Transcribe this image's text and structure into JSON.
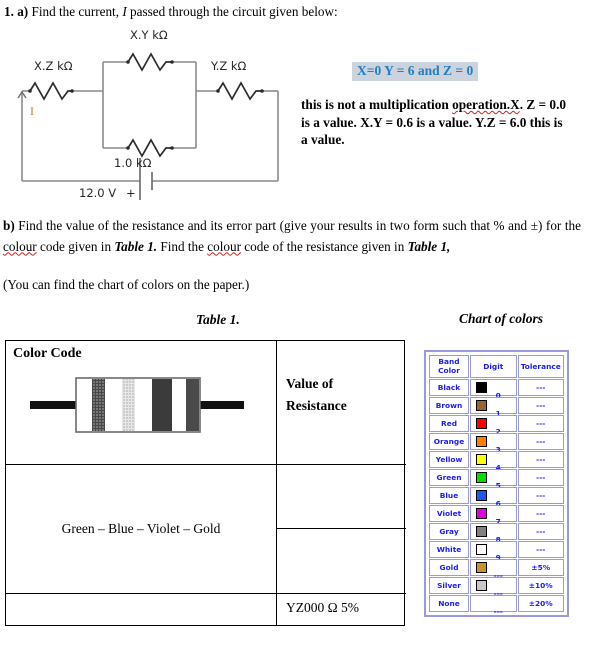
{
  "part_a": {
    "heading_number": "1. a)",
    "heading_text": " Find the current, ",
    "heading_var": "I",
    "heading_rest": " passed through the circuit given below:"
  },
  "circuit": {
    "top_resistor_label": "X.Y kΩ",
    "left_resistor_label": "X.Z kΩ",
    "right_resistor_label": "Y.Z kΩ",
    "bottom_resistor_label": "1.0 kΩ",
    "source_label": "12.0 V",
    "source_polarity": "+",
    "current_label": "I",
    "current_label_color": "#c08020",
    "wire_color": "#7f7f7f",
    "component_color": "#2b2b2b"
  },
  "notes": {
    "highlight": "X=0 Y = 6 and Z = 0",
    "highlight_color": "#1f7fc4",
    "highlight_bg": "#ccd3dd",
    "line1a": "this is not a multiplication ",
    "line1b": "operation.X",
    "line1c": ". Z = 0.0 is a value.",
    "line2": "X.Y = 0.6 is a value. Y.Z = 6.0 this is a value."
  },
  "part_b": {
    "label": "b)",
    "paragraph_1": " Find the value of the resistance and its error part (give your results in two form such that % and ±) for the ",
    "colour_word_1": "colour",
    "paragraph_2": " code given in ",
    "table_ref_1": "Table 1.",
    "paragraph_3": " Find the ",
    "colour_word_2": "colour",
    "paragraph_4": " code of the resistance given in ",
    "table_ref_2": "Table 1,",
    "paragraph_5": "(You can find the chart of colors on the paper.)"
  },
  "captions": {
    "table": "Table 1.",
    "chart": "Chart of colors"
  },
  "table1": {
    "header_left": "Color Code",
    "header_right": "Value of Resistance",
    "value_of_line1": "Value of",
    "value_of_line2": "Resistance",
    "color_code_answer": "Green – Blue – Violet – Gold",
    "resistance_value": "YZ000 Ω 5%",
    "resistor_bands": [
      "#555555",
      "#d8d8d8",
      "#3a3a3a",
      "#4a4a4a"
    ]
  },
  "color_chart": {
    "headers": [
      "Band Color",
      "Digit",
      "Tolerance"
    ],
    "header_band_line1": "Band",
    "header_band_line2": "Color",
    "header_digit": "Digit",
    "header_tolerance": "Tolerance",
    "rows": [
      {
        "name": "Black",
        "swatch": "#000000",
        "digit": "0",
        "tolerance": "---"
      },
      {
        "name": "Brown",
        "swatch": "#99642e",
        "digit": "1",
        "tolerance": "---"
      },
      {
        "name": "Red",
        "swatch": "#ff0000",
        "digit": "2",
        "tolerance": "---"
      },
      {
        "name": "Orange",
        "swatch": "#ff7f00",
        "digit": "3",
        "tolerance": "---"
      },
      {
        "name": "Yellow",
        "swatch": "#ffff00",
        "digit": "4",
        "tolerance": "---"
      },
      {
        "name": "Green",
        "swatch": "#00e000",
        "digit": "5",
        "tolerance": "---"
      },
      {
        "name": "Blue",
        "swatch": "#2255ee",
        "digit": "6",
        "tolerance": "---"
      },
      {
        "name": "Violet",
        "swatch": "#e000e0",
        "digit": "7",
        "tolerance": "---"
      },
      {
        "name": "Gray",
        "swatch": "#808080",
        "digit": "8",
        "tolerance": "---"
      },
      {
        "name": "White",
        "swatch": "#ffffff",
        "digit": "9",
        "tolerance": "---"
      },
      {
        "name": "Gold",
        "swatch": "#c8922e",
        "digit": "---",
        "tolerance": "±5%"
      },
      {
        "name": "Silver",
        "swatch": "#c8c8c8",
        "digit": "---",
        "tolerance": "±10%"
      },
      {
        "name": "None",
        "swatch": "",
        "digit": "---",
        "tolerance": "±20%"
      }
    ],
    "border_color": "#9999e0",
    "text_color": "#1a1aff"
  }
}
